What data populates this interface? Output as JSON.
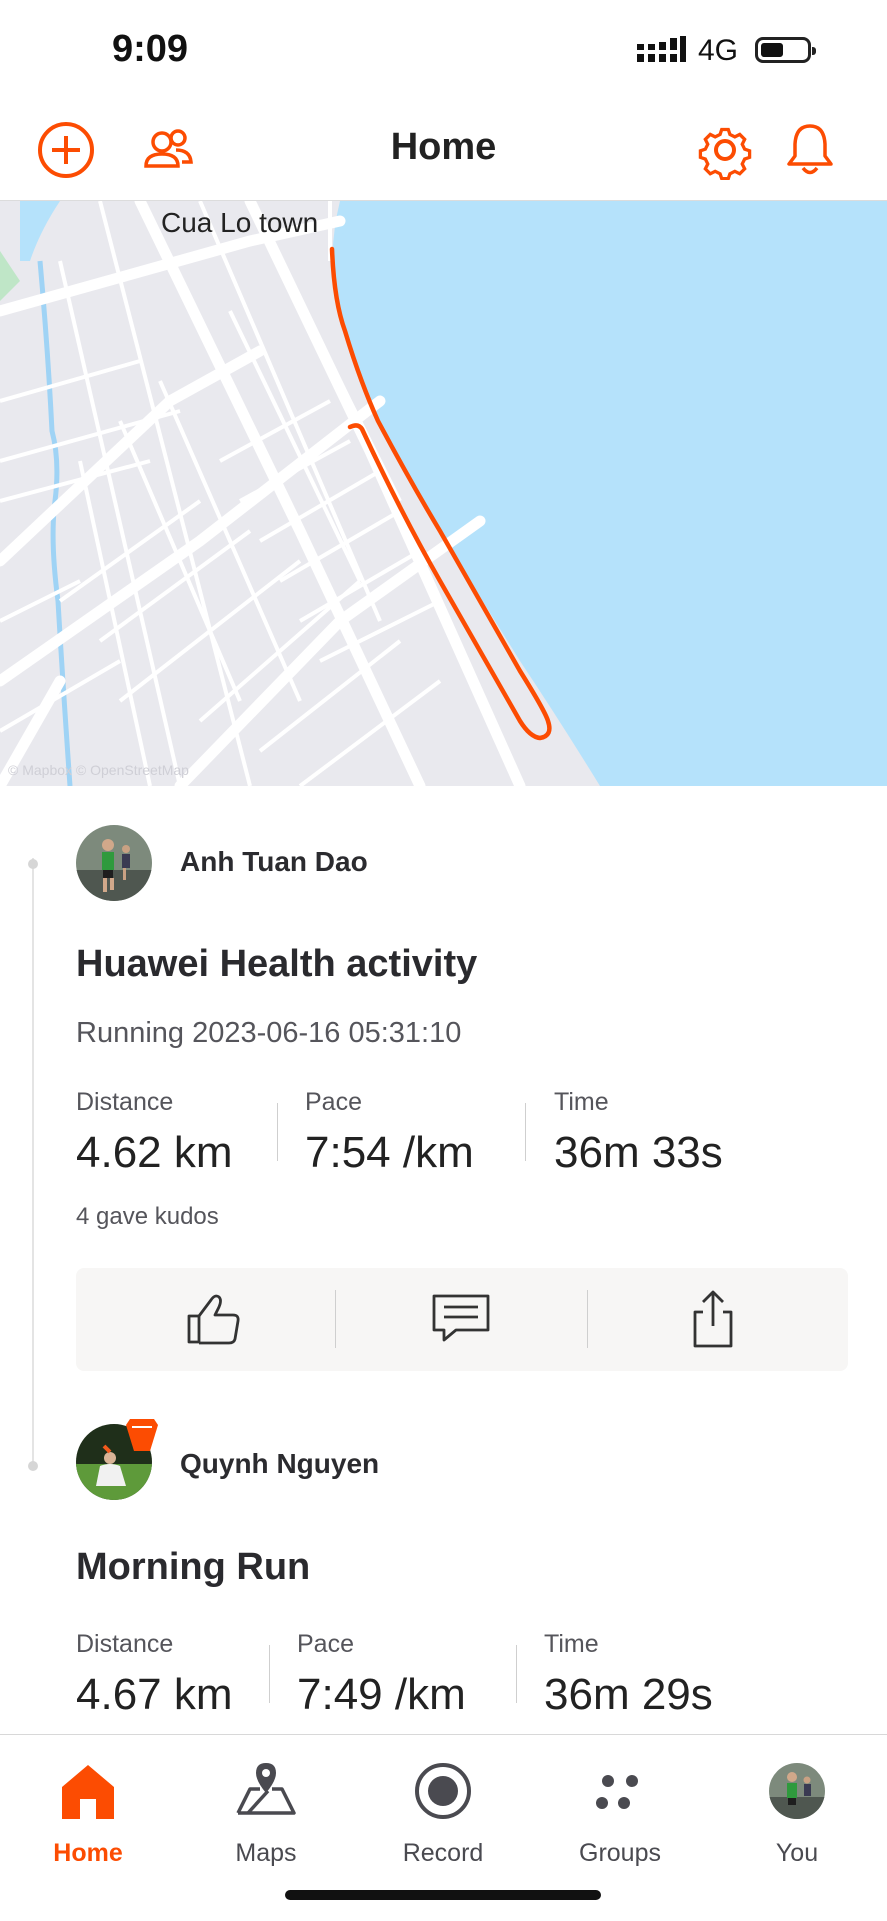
{
  "status_bar": {
    "time": "9:09",
    "network": "4G"
  },
  "header": {
    "title": "Home"
  },
  "map": {
    "place_label": "Cua Lo town",
    "attribution": "© Mapbox © OpenStreetMap"
  },
  "colors": {
    "accent": "#fc4c02",
    "route": "#fc4c02",
    "water": "#b5e2fb",
    "land": "#e9e9ee"
  },
  "feed": [
    {
      "athlete": "Anh Tuan Dao",
      "title": "Huawei Health activity",
      "meta": "Running 2023-06-16 05:31:10",
      "stats": [
        {
          "label": "Distance",
          "value": "4.62 km"
        },
        {
          "label": "Pace",
          "value": "7:54 /km"
        },
        {
          "label": "Time",
          "value": "36m 33s"
        }
      ],
      "kudos": "4 gave kudos",
      "actions": [
        "kudos-icon",
        "comment-icon",
        "share-icon"
      ]
    },
    {
      "athlete": "Quynh Nguyen",
      "title": "Morning Run",
      "stats": [
        {
          "label": "Distance",
          "value": "4.67 km"
        },
        {
          "label": "Pace",
          "value": "7:49 /km"
        },
        {
          "label": "Time",
          "value": "36m 29s"
        }
      ]
    }
  ],
  "tabbar": {
    "tabs": [
      {
        "label": "Home",
        "icon": "home-icon",
        "active": true
      },
      {
        "label": "Maps",
        "icon": "maps-icon"
      },
      {
        "label": "Record",
        "icon": "record-icon"
      },
      {
        "label": "Groups",
        "icon": "groups-icon"
      },
      {
        "label": "You",
        "icon": "avatar"
      }
    ]
  }
}
